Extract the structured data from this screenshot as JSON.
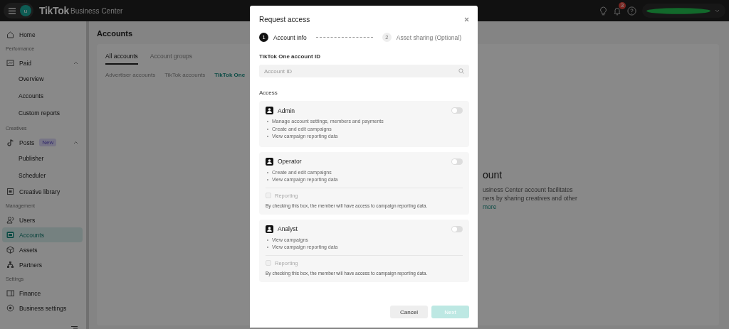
{
  "top_bar": {
    "avatar_letter": "u",
    "logo": "TikTok",
    "product": "Business Center",
    "notification_count": "3"
  },
  "sidebar": {
    "items": [
      {
        "kind": "item",
        "label": "Home",
        "selected": false
      },
      {
        "kind": "section",
        "label": "Performance"
      },
      {
        "kind": "item",
        "label": "Paid",
        "selected": false,
        "expanded": true
      },
      {
        "kind": "subitem",
        "label": "Overview",
        "selected": false
      },
      {
        "kind": "subitem",
        "label": "Accounts",
        "selected": false
      },
      {
        "kind": "subitem",
        "label": "Custom reports",
        "selected": false
      },
      {
        "kind": "section",
        "label": "Creatives"
      },
      {
        "kind": "item",
        "label": "Posts",
        "badge": "New",
        "selected": false,
        "expanded": true
      },
      {
        "kind": "subitem",
        "label": "Publisher",
        "selected": false
      },
      {
        "kind": "subitem",
        "label": "Scheduler",
        "selected": false
      },
      {
        "kind": "item",
        "label": "Creative library",
        "selected": false
      },
      {
        "kind": "section",
        "label": "Management"
      },
      {
        "kind": "item",
        "label": "Users",
        "selected": false
      },
      {
        "kind": "item",
        "label": "Accounts",
        "selected": true
      },
      {
        "kind": "item",
        "label": "Assets",
        "selected": false
      },
      {
        "kind": "item",
        "label": "Partners",
        "selected": false
      },
      {
        "kind": "section",
        "label": "Settings"
      },
      {
        "kind": "item",
        "label": "Finance",
        "selected": false
      },
      {
        "kind": "item",
        "label": "Business settings",
        "selected": false
      }
    ]
  },
  "page": {
    "title": "Accounts",
    "tabs": [
      {
        "label": "All accounts",
        "selected": true
      },
      {
        "label": "Account groups",
        "selected": false
      }
    ],
    "sub_tabs": [
      {
        "label": "Advertiser accounts",
        "selected": false
      },
      {
        "label": "TikTok accounts",
        "selected": false
      },
      {
        "label": "TikTok One",
        "selected": true
      }
    ],
    "empty_state": {
      "title": "ount",
      "lines": [
        "usiness Center account facilitates",
        "ners by sharing creatives and other"
      ],
      "link": "more"
    }
  },
  "modal": {
    "title": "Request access",
    "steps": [
      {
        "number": "1",
        "label": "Account info",
        "selected": true
      },
      {
        "number": "2",
        "label": "Asset sharing (Optional)",
        "selected": false
      }
    ],
    "field": {
      "label": "TikTok One account ID",
      "placeholder": "Account ID"
    },
    "access_label": "Access",
    "roles": [
      {
        "name": "Admin",
        "on": false,
        "permissions": [
          "Manage account settings, members and payments",
          "Create and edit campaigns",
          "View campaign reporting data"
        ]
      },
      {
        "name": "Operator",
        "on": false,
        "permissions": [
          "Create and edit campaigns",
          "View campaign reporting data"
        ],
        "reporting": {
          "label": "Reporting",
          "checked": false,
          "disabled": true,
          "note": "By checking this box, the member will have access to campaign reporting data."
        }
      },
      {
        "name": "Analyst",
        "on": false,
        "permissions": [
          "View campaigns",
          "View campaign reporting data"
        ],
        "reporting": {
          "label": "Reporting",
          "checked": false,
          "disabled": true,
          "note": "By checking this box, the member will have access to campaign reporting data."
        }
      }
    ],
    "buttons": [
      {
        "label": "Cancel",
        "kind": "secondary",
        "disabled": false
      },
      {
        "label": "Next",
        "kind": "primary",
        "disabled": true
      }
    ]
  }
}
